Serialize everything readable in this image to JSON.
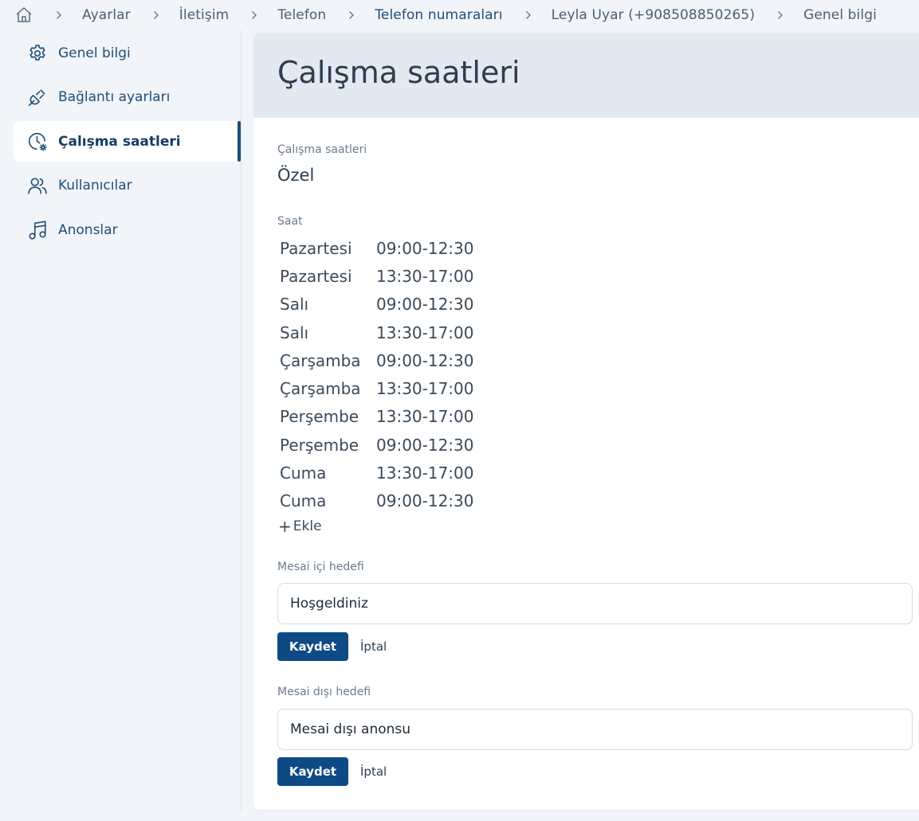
{
  "breadcrumb": {
    "items": [
      {
        "label": "Ayarlar"
      },
      {
        "label": "İletişim"
      },
      {
        "label": "Telefon"
      },
      {
        "label": "Telefon numaraları"
      },
      {
        "label": "Leyla Uyar (+908508850265)"
      },
      {
        "label": "Genel bilgi"
      }
    ]
  },
  "sidebar": {
    "items": [
      {
        "label": "Genel bilgi",
        "icon": "gear-icon"
      },
      {
        "label": "Bağlantı ayarları",
        "icon": "plug-icon"
      },
      {
        "label": "Çalışma saatleri",
        "icon": "clock-gear-icon",
        "active": true
      },
      {
        "label": "Kullanıcılar",
        "icon": "users-icon"
      },
      {
        "label": "Anonslar",
        "icon": "music-note-icon"
      }
    ]
  },
  "main": {
    "title": "Çalışma saatleri",
    "working_hours_label": "Çalışma saatleri",
    "working_hours_value": "Özel",
    "hours_label": "Saat",
    "hours": [
      {
        "day": "Pazartesi",
        "time": "09:00-12:30"
      },
      {
        "day": "Pazartesi",
        "time": "13:30-17:00"
      },
      {
        "day": "Salı",
        "time": "09:00-12:30"
      },
      {
        "day": "Salı",
        "time": "13:30-17:00"
      },
      {
        "day": "Çarşamba",
        "time": "09:00-12:30"
      },
      {
        "day": "Çarşamba",
        "time": "13:30-17:00"
      },
      {
        "day": "Perşembe",
        "time": "13:30-17:00"
      },
      {
        "day": "Perşembe",
        "time": "09:00-12:30"
      },
      {
        "day": "Cuma",
        "time": "13:30-17:00"
      },
      {
        "day": "Cuma",
        "time": "09:00-12:30"
      }
    ],
    "add_label": "Ekle",
    "in_hours": {
      "label": "Mesai içi hedefi",
      "value": "Hoşgeldiniz",
      "save_label": "Kaydet",
      "cancel_label": "İptal"
    },
    "out_hours": {
      "label": "Mesai dışı hedefi",
      "value": "Mesai dışı anonsu",
      "save_label": "Kaydet",
      "cancel_label": "İptal"
    }
  },
  "colors": {
    "accent": "#0e4a86",
    "link": "#1f4e79",
    "header_bg": "#e3e9f0",
    "page_bg": "#f1f4f8"
  }
}
